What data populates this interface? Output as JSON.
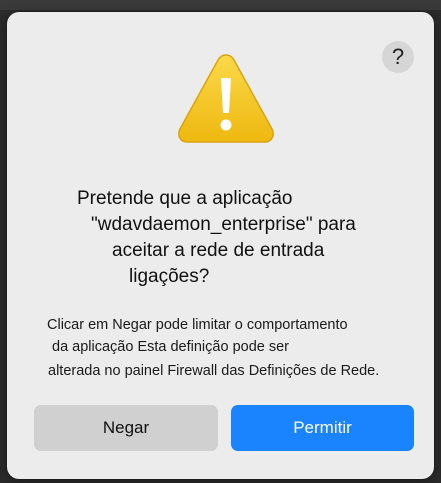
{
  "dialog": {
    "help_label": "?",
    "icon": "warning-triangle-icon",
    "title_lines": [
      "Pretende que a aplicação",
      "\"wdavdaemon_enterprise\" para",
      "aceitar a rede de entrada",
      "ligações?"
    ],
    "body_lines": [
      "Clicar em Negar pode limitar o comportamento",
      "da aplicação Esta definição pode ser",
      "alterada no painel Firewall das Definições de Rede."
    ],
    "buttons": {
      "deny_label": "Negar",
      "allow_label": "Permitir"
    }
  },
  "colors": {
    "dialog_background": "#ececec",
    "primary_button": "#1a84ff",
    "secondary_button": "#d0d0d0",
    "warning_yellow": "#f4c21a"
  }
}
